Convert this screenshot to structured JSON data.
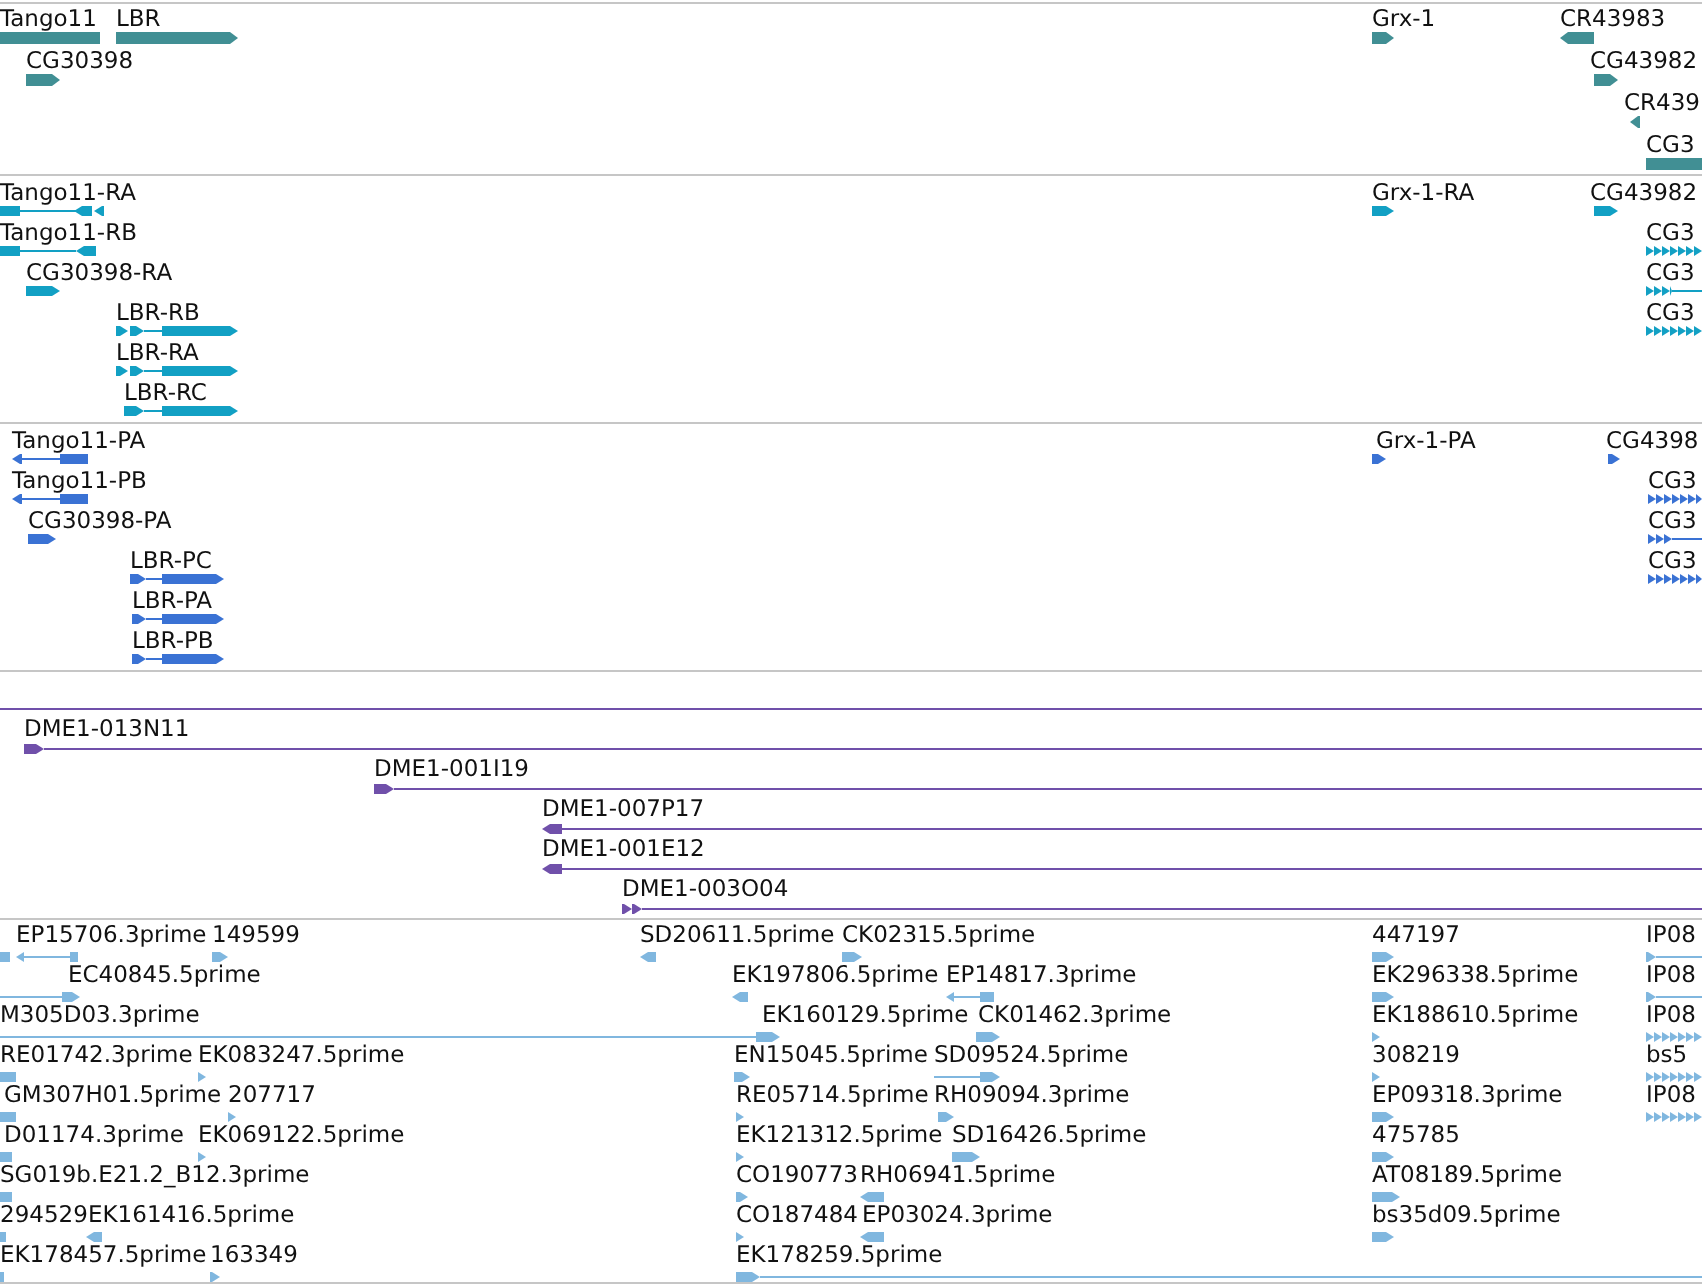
{
  "tracks": [
    {
      "kind": "gene",
      "features": [
        {
          "label": "Tango11"
        },
        {
          "label": "LBR",
          "reverse": false
        },
        {
          "label": "Grx-1",
          "reverse": false
        },
        {
          "label": "CR43983",
          "reverse": true
        },
        {
          "label": "CG30398",
          "reverse": false
        },
        {
          "label": "CG43982",
          "reverse": false
        },
        {
          "label": "CR439",
          "reverse": true
        },
        {
          "label": "CG3"
        }
      ]
    },
    {
      "kind": "transcript",
      "features": [
        {
          "label": "Tango11-RA",
          "reverse": true
        },
        {
          "label": "Grx-1-RA",
          "reverse": false
        },
        {
          "label": "CG43982",
          "reverse": false
        },
        {
          "label": "Tango11-RB",
          "reverse": true
        },
        {
          "label": "CG3",
          "reverse": false
        },
        {
          "label": "CG30398-RA",
          "reverse": false
        },
        {
          "label": "CG3",
          "reverse": false
        },
        {
          "label": "LBR-RB",
          "reverse": false
        },
        {
          "label": "CG3",
          "reverse": false
        },
        {
          "label": "LBR-RA",
          "reverse": false
        },
        {
          "label": "LBR-RC",
          "reverse": false
        }
      ]
    },
    {
      "kind": "polypeptide",
      "features": [
        {
          "label": "Tango11-PA",
          "reverse": true
        },
        {
          "label": "Grx-1-PA",
          "reverse": false
        },
        {
          "label": "CG4398",
          "reverse": false
        },
        {
          "label": "Tango11-PB",
          "reverse": true
        },
        {
          "label": "CG3",
          "reverse": false
        },
        {
          "label": "CG30398-PA",
          "reverse": false
        },
        {
          "label": "CG3",
          "reverse": false
        },
        {
          "label": "LBR-PC",
          "reverse": false
        },
        {
          "label": "CG3",
          "reverse": false
        },
        {
          "label": "LBR-PA",
          "reverse": false
        },
        {
          "label": "LBR-PB",
          "reverse": false
        }
      ]
    },
    {
      "kind": "clone",
      "features": [
        {
          "label": "DME1-013N11",
          "reverse": false
        },
        {
          "label": "DME1-001I19",
          "reverse": false
        },
        {
          "label": "DME1-007P17",
          "reverse": true
        },
        {
          "label": "DME1-001E12",
          "reverse": true
        },
        {
          "label": "DME1-003O04",
          "reverse": false
        }
      ]
    },
    {
      "kind": "est",
      "features": [
        {
          "label": "EP15706.3prime",
          "reverse": true
        },
        {
          "label": "149599",
          "reverse": false
        },
        {
          "label": "SD20611.5prime",
          "reverse": true
        },
        {
          "label": "CK02315.5prime",
          "reverse": false
        },
        {
          "label": "447197",
          "reverse": false
        },
        {
          "label": "IP08",
          "reverse": false
        },
        {
          "label": "EC40845.5prime",
          "reverse": false
        },
        {
          "label": "EK197806.5prime",
          "reverse": true
        },
        {
          "label": "EP14817.3prime",
          "reverse": true
        },
        {
          "label": "EK296338.5prime",
          "reverse": false
        },
        {
          "label": "IP08",
          "reverse": false
        },
        {
          "label": "M305D03.3prime"
        },
        {
          "label": "EK160129.5prime",
          "reverse": false
        },
        {
          "label": "CK01462.3prime",
          "reverse": false
        },
        {
          "label": "EK188610.5prime",
          "reverse": false
        },
        {
          "label": "IP08",
          "reverse": false
        },
        {
          "label": "RE01742.3prime"
        },
        {
          "label": "EK083247.5prime",
          "reverse": false
        },
        {
          "label": "EN15045.5prime",
          "reverse": false
        },
        {
          "label": "SD09524.5prime",
          "reverse": false
        },
        {
          "label": "308219",
          "reverse": false
        },
        {
          "label": "bs5",
          "reverse": false
        },
        {
          "label": "GM307H01.5prime"
        },
        {
          "label": "207717",
          "reverse": false
        },
        {
          "label": "RE05714.5prime",
          "reverse": false
        },
        {
          "label": "RH09094.3prime",
          "reverse": false
        },
        {
          "label": "EP09318.3prime",
          "reverse": false
        },
        {
          "label": "IP08",
          "reverse": false
        },
        {
          "label": "D01174.3prime"
        },
        {
          "label": "EK069122.5prime",
          "reverse": false
        },
        {
          "label": "EK121312.5prime",
          "reverse": false
        },
        {
          "label": "SD16426.5prime",
          "reverse": false
        },
        {
          "label": "475785",
          "reverse": false
        },
        {
          "label": "SG019b.E21.2_B12.3prime"
        },
        {
          "label": "CO190773",
          "reverse": false
        },
        {
          "label": "RH06941.5prime",
          "reverse": true
        },
        {
          "label": "AT08189.5prime",
          "reverse": false
        },
        {
          "label": "294529"
        },
        {
          "label": "EK161416.5prime",
          "reverse": true
        },
        {
          "label": "CO187484",
          "reverse": false
        },
        {
          "label": "EP03024.3prime",
          "reverse": true
        },
        {
          "label": "bs35d09.5prime",
          "reverse": false
        },
        {
          "label": "EK178457.5prime"
        },
        {
          "label": "163349",
          "reverse": false
        },
        {
          "label": "EK178259.5prime",
          "reverse": false
        }
      ]
    }
  ]
}
